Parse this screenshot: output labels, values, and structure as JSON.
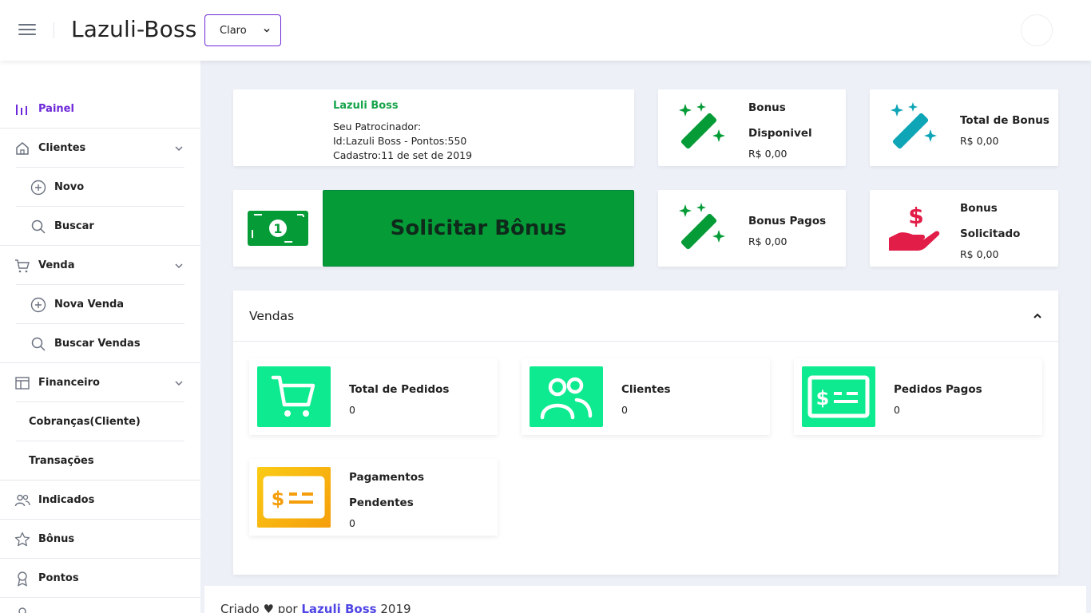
{
  "header": {
    "brand": "Lazuli-Boss",
    "theme_select_value": "Claro"
  },
  "sidebar": {
    "items": [
      {
        "label": "Painel",
        "icon": "chart-bars-icon"
      },
      {
        "label": "Clientes",
        "icon": "home-icon"
      },
      {
        "label": "Novo",
        "icon": "plus-circle-icon"
      },
      {
        "label": "Buscar",
        "icon": "search-icon"
      },
      {
        "label": "Venda",
        "icon": "cart-icon"
      },
      {
        "label": "Nova Venda",
        "icon": "plus-circle-icon"
      },
      {
        "label": "Buscar Vendas",
        "icon": "search-icon"
      },
      {
        "label": "Financeiro",
        "icon": "layout-icon"
      },
      {
        "label": "Cobranças(Cliente)"
      },
      {
        "label": "Transações"
      },
      {
        "label": "Indicados",
        "icon": "users-icon"
      },
      {
        "label": "Bônus",
        "icon": "star-icon"
      },
      {
        "label": "Pontos",
        "icon": "award-icon"
      }
    ]
  },
  "profile": {
    "name": "Lazuli Boss",
    "sponsor_label": "Seu Patrocinador:",
    "id_line": "Id:Lazuli Boss - Pontos:550",
    "registered": "Cadastro:11 de set de 2019"
  },
  "stats": {
    "bonus_disponivel": {
      "title_line1": "Bonus",
      "title_line2": "Disponivel",
      "value": "R$ 0,00"
    },
    "total_bonus": {
      "title": "Total de Bonus",
      "value": "R$ 0,00"
    },
    "bonus_pagos": {
      "title": "Bonus Pagos",
      "value": "R$ 0,00"
    },
    "bonus_solicitado": {
      "title_line1": "Bonus",
      "title_line2": "Solicitado",
      "value": "R$ 0,00"
    }
  },
  "request_button": "Solicitar Bônus",
  "vendas": {
    "title": "Vendas",
    "cards": [
      {
        "title": "Total de Pedidos",
        "value": "0"
      },
      {
        "title": "Clientes",
        "value": "0"
      },
      {
        "title": "Pedidos Pagos",
        "value": "0"
      },
      {
        "title_line1": "Pagamentos",
        "title_line2": "Pendentes",
        "value": "0"
      }
    ]
  },
  "footer": {
    "prefix": "Criado",
    "by": "por",
    "link": "Lazuli Boss",
    "year": "2019"
  },
  "colors": {
    "accent": "#6d28d9",
    "green": "#059c38",
    "mint": "#0eea8f",
    "teal": "#0ea5b7",
    "red": "#e11d48",
    "yellow": "#facc15"
  }
}
